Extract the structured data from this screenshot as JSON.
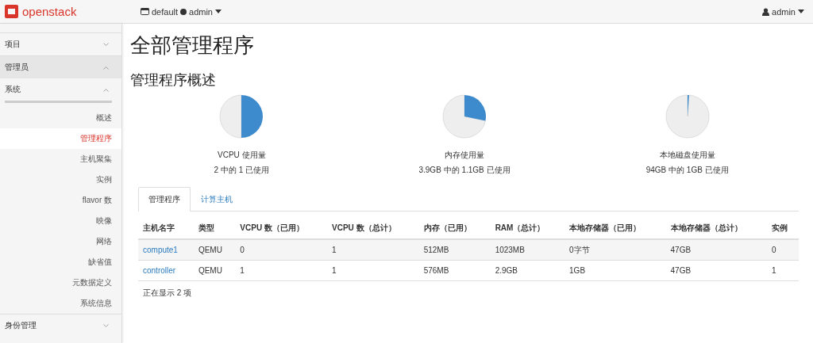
{
  "topbar": {
    "brand": "openstack",
    "project_menu": {
      "domain": "default",
      "project": "admin"
    },
    "user_menu": {
      "user": "admin"
    }
  },
  "sidebar": {
    "panels": [
      {
        "label": "项目",
        "expanded": false
      },
      {
        "label": "管理员",
        "expanded": true,
        "children": [
          {
            "label": "系统",
            "expanded": true,
            "children": [
              {
                "label": "概述",
                "selected": false
              },
              {
                "label": "管理程序",
                "selected": true
              },
              {
                "label": "主机聚集",
                "selected": false
              },
              {
                "label": "实例",
                "selected": false
              },
              {
                "label": "flavor 数",
                "selected": false
              },
              {
                "label": "映像",
                "selected": false
              },
              {
                "label": "网络",
                "selected": false
              },
              {
                "label": "缺省值",
                "selected": false
              },
              {
                "label": "元数据定义",
                "selected": false
              },
              {
                "label": "系统信息",
                "selected": false
              }
            ]
          }
        ]
      },
      {
        "label": "身份管理",
        "expanded": false
      }
    ]
  },
  "page_title": "全部管理程序",
  "overview": {
    "title": "管理程序概述",
    "meters": [
      {
        "label": "VCPU 使用量",
        "reading": "2 中的 1 已使用",
        "chart_data": {
          "type": "pie",
          "values": [
            50,
            50
          ]
        }
      },
      {
        "label": "内存使用量",
        "reading": "3.9GB 中的 1.1GB 已使用",
        "chart_data": {
          "type": "pie",
          "values": [
            28.2,
            71.8
          ]
        }
      },
      {
        "label": "本地磁盘使用量",
        "reading": "94GB 中的 1GB 已使用",
        "chart_data": {
          "type": "pie",
          "values": [
            1.1,
            98.9
          ]
        }
      }
    ]
  },
  "tabs": [
    {
      "label": "管理程序",
      "selected": true
    },
    {
      "label": "计算主机",
      "selected": false
    }
  ],
  "table": {
    "columns": [
      "主机名字",
      "类型",
      "VCPU 数（已用）",
      "VCPU 数（总计）",
      "内存（已用）",
      "RAM（总计）",
      "本地存储器（已用）",
      "本地存储器（总计）",
      "实例"
    ],
    "rows": [
      [
        "compute1",
        "QEMU",
        "0",
        "1",
        "512MB",
        "1023MB",
        "0字节",
        "47GB",
        "0"
      ],
      [
        "controller",
        "QEMU",
        "1",
        "1",
        "576MB",
        "2.9GB",
        "1GB",
        "47GB",
        "1"
      ]
    ],
    "footer": "正在显示 2 项"
  }
}
